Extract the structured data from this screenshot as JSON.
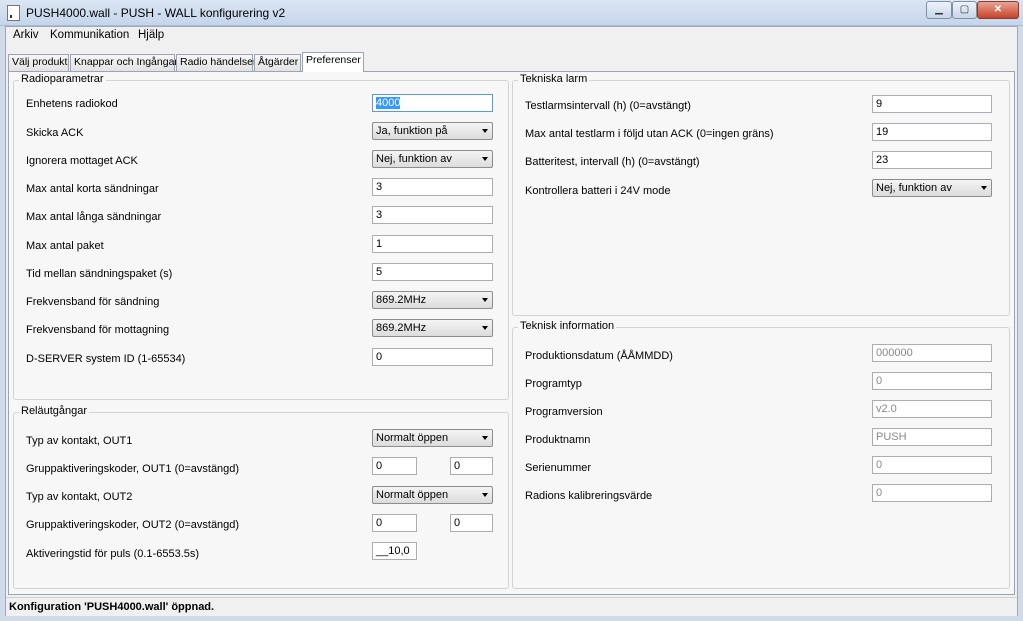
{
  "window": {
    "title": "PUSH4000.wall - PUSH - WALL konfigurering v2"
  },
  "menu": [
    "Arkiv",
    "Kommunikation",
    "Hjälp"
  ],
  "tabs": [
    "Välj produkt",
    "Knappar och Ingångar",
    "Radio händelser",
    "Åtgärder",
    "Preferenser"
  ],
  "radio": {
    "title": "Radioparametrar",
    "device_code_label": "Enhetens radiokod",
    "device_code": "4000",
    "send_ack_label": "Skicka ACK",
    "send_ack": "Ja, funktion på",
    "ignore_ack_label": "Ignorera mottaget ACK",
    "ignore_ack": "Nej, funktion av",
    "max_short_label": "Max antal korta sändningar",
    "max_short": "3",
    "max_long_label": "Max antal långa sändningar",
    "max_long": "3",
    "max_packets_label": "Max antal paket",
    "max_packets": "1",
    "packet_interval_label": "Tid mellan sändningspaket (s)",
    "packet_interval": "5",
    "tx_band_label": "Frekvensband för sändning",
    "tx_band": "869.2MHz",
    "rx_band_label": "Frekvensband för mottagning",
    "rx_band": "869.2MHz",
    "dserver_label": "D-SERVER system ID (1-65534)",
    "dserver": "0"
  },
  "relay": {
    "title": "Reläutgångar",
    "out1_type_label": "Typ av kontakt, OUT1",
    "out1_type": "Normalt öppen",
    "out1_codes_label": "Gruppaktiveringskoder, OUT1 (0=avstängd)",
    "out1_code_a": "0",
    "out1_code_b": "0",
    "out2_type_label": "Typ av kontakt, OUT2",
    "out2_type": "Normalt öppen",
    "out2_codes_label": "Gruppaktiveringskoder, OUT2 (0=avstängd)",
    "out2_code_a": "0",
    "out2_code_b": "0",
    "pulse_label": "Aktiveringstid för puls (0.1-6553.5s)",
    "pulse": "__10,0"
  },
  "alarm": {
    "title": "Tekniska larm",
    "test_interval_label": "Testlarmsintervall (h) (0=avstängt)",
    "test_interval": "9",
    "max_tests_label": "Max antal testlarm i följd utan ACK (0=ingen gräns)",
    "max_tests": "19",
    "battery_interval_label": "Batteritest, intervall (h) (0=avstängt)",
    "battery_interval": "23",
    "check_battery_label": "Kontrollera batteri i 24V mode",
    "check_battery": "Nej, funktion av"
  },
  "info": {
    "title": "Teknisk information",
    "prod_date_label": "Produktionsdatum (ÅÅMMDD)",
    "prod_date": "000000",
    "prog_type_label": "Programtyp",
    "prog_type": "0",
    "prog_version_label": "Programversion",
    "prog_version": "v2.0",
    "product_name_label": "Produktnamn",
    "product_name": "PUSH",
    "serial_label": "Serienummer",
    "serial": "0",
    "calib_label": "Radions kalibreringsvärde",
    "calib": "0"
  },
  "status": "Konfiguration 'PUSH4000.wall' öppnad."
}
